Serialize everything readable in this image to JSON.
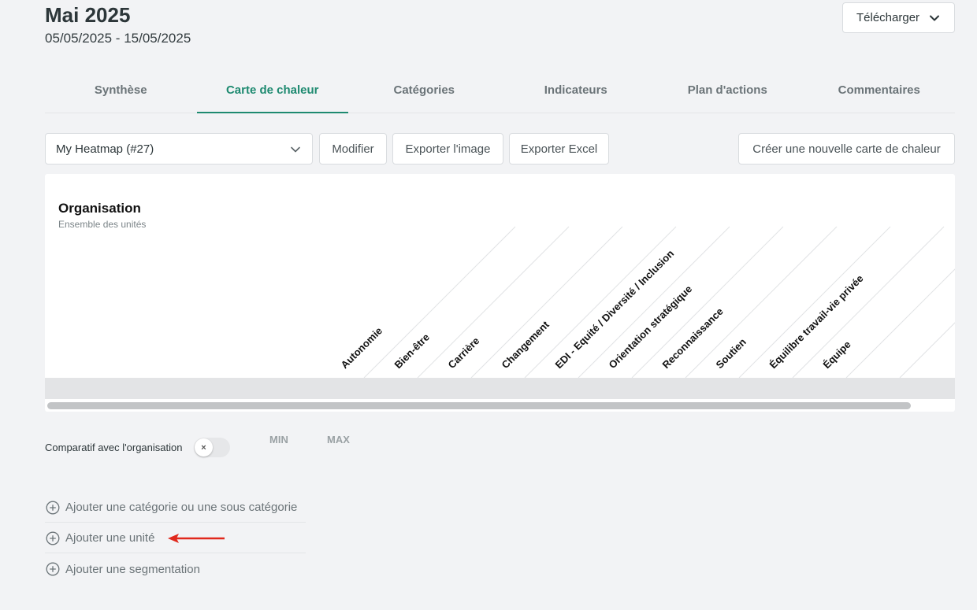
{
  "header": {
    "title": "Mai 2025",
    "date_range": "05/05/2025 - 15/05/2025",
    "download_label": "Télécharger"
  },
  "tabs": [
    {
      "label": "Synthèse",
      "active": false
    },
    {
      "label": "Carte de chaleur",
      "active": true
    },
    {
      "label": "Catégories",
      "active": false
    },
    {
      "label": "Indicateurs",
      "active": false
    },
    {
      "label": "Plan d'actions",
      "active": false
    },
    {
      "label": "Commentaires",
      "active": false
    }
  ],
  "toolbar": {
    "heatmap_select": "My Heatmap (#27)",
    "modify_label": "Modifier",
    "export_image_label": "Exporter l'image",
    "export_excel_label": "Exporter Excel",
    "create_label": "Créer une nouvelle carte de chaleur"
  },
  "heatmap": {
    "title": "Organisation",
    "subtitle": "Ensemble des unités",
    "columns": [
      "Autonomie",
      "Bien-être",
      "Carrière",
      "Changement",
      "EDI - Equité / Diversité / Inclusion",
      "Orientation stratégique",
      "Reconnaissance",
      "Soutien",
      "Équilibre travail-vie privée",
      "Équipe"
    ]
  },
  "comparison": {
    "label": "Comparatif avec l'organisation",
    "toggle_on": false,
    "min_label": "MIN",
    "max_label": "MAX"
  },
  "actions": {
    "add_category": "Ajouter une catégorie ou une sous catégorie",
    "add_unit": "Ajouter une unité",
    "add_segmentation": "Ajouter une segmentation"
  },
  "colors": {
    "accent": "#1e8a70",
    "annotation_arrow": "#e0281c"
  }
}
